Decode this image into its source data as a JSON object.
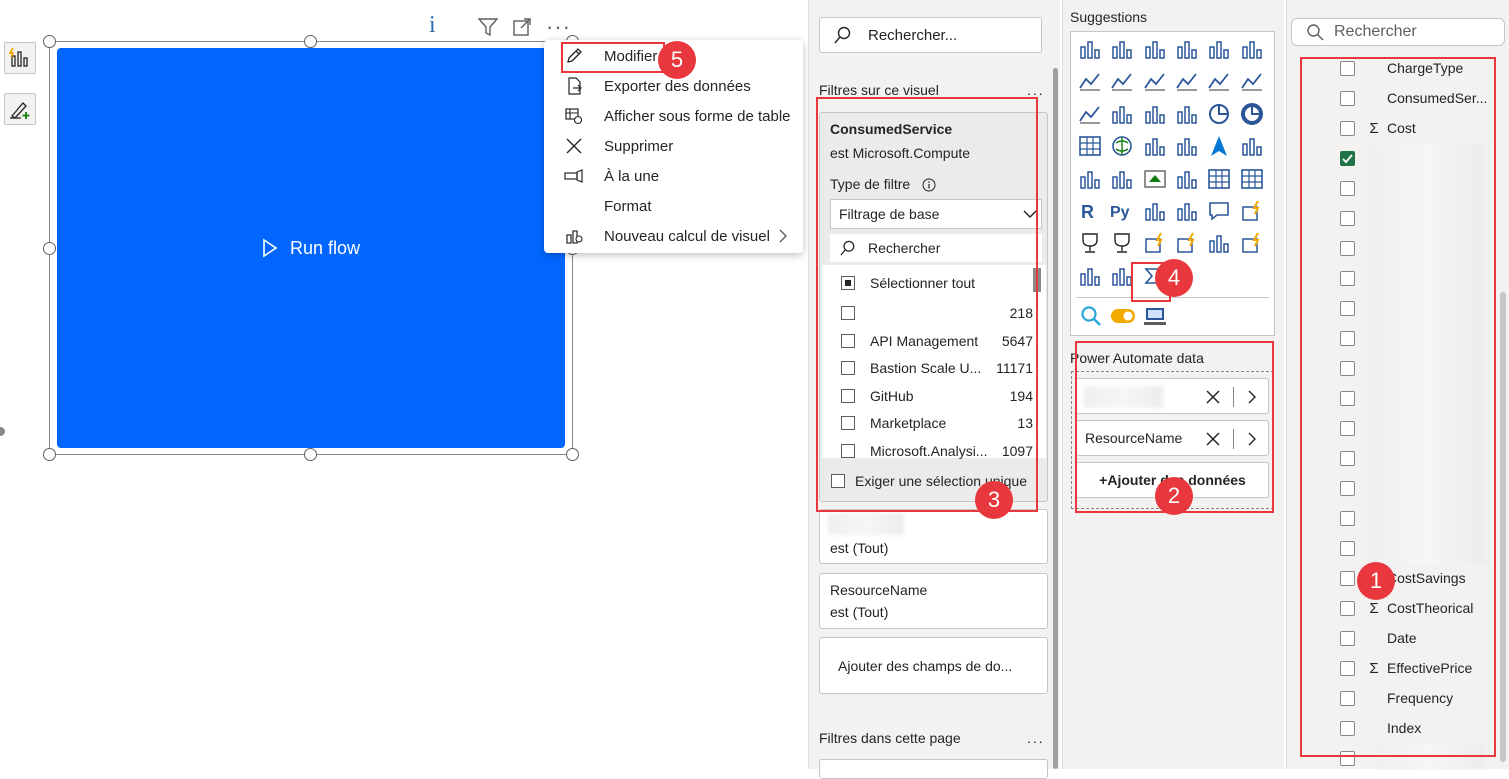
{
  "canvas": {
    "run_flow_label": "Run flow",
    "header_icons": [
      "info-icon",
      "filter-icon",
      "focus-mode-icon",
      "more-options-icon"
    ],
    "more_options": "···",
    "info_glyph": "i"
  },
  "context_menu": {
    "items": [
      {
        "label": "Modifier",
        "icon": "pencil-icon"
      },
      {
        "label": "Exporter des données",
        "icon": "export-icon"
      },
      {
        "label": "Afficher sous forme de table",
        "icon": "table-view-icon"
      },
      {
        "label": "Supprimer",
        "icon": "close-icon"
      },
      {
        "label": "À la une",
        "icon": "spotlight-icon"
      },
      {
        "label": "Format",
        "icon": ""
      },
      {
        "label": "Nouveau calcul de visuel",
        "icon": "calculator-icon"
      }
    ]
  },
  "filters": {
    "search_placeholder": "Rechercher...",
    "section_visual": "Filtres sur ce visuel",
    "section_page": "Filtres dans cette page",
    "more": "...",
    "active_card": {
      "title": "ConsumedService",
      "subtitle": "est Microsoft.Compute",
      "filter_type_label": "Type de filtre",
      "filter_type_value": "Filtrage de base",
      "search_placeholder": "Rechercher",
      "select_all": "Sélectionner tout",
      "rows": [
        {
          "label": "",
          "count": "218"
        },
        {
          "label": "API Management",
          "count": "5647"
        },
        {
          "label": "Bastion Scale U...",
          "count": "11171"
        },
        {
          "label": "GitHub",
          "count": "194"
        },
        {
          "label": "Marketplace",
          "count": "13"
        },
        {
          "label": "Microsoft.Analysi...",
          "count": "1097"
        }
      ],
      "require_single": "Exiger une sélection unique"
    },
    "card2_value": "est (Tout)",
    "card3_title": "ResourceName",
    "card3_value": "est (Tout)",
    "add_fields": "Ajouter des champs de do..."
  },
  "visualizations": {
    "suggestions_label": "Suggestions",
    "power_automate_label": "Power Automate data",
    "well_2_label": "ResourceName",
    "add_data": "+Ajouter des données"
  },
  "data": {
    "search_placeholder": "Rechercher",
    "fields": [
      {
        "name": "ChargeType",
        "sigma": false,
        "checked": false
      },
      {
        "name": "ConsumedSer...",
        "sigma": false,
        "checked": false
      },
      {
        "name": "Cost",
        "sigma": true,
        "checked": false
      },
      {
        "name": "",
        "sigma": false,
        "checked": true
      },
      {
        "name": "",
        "sigma": false,
        "checked": false
      },
      {
        "name": "",
        "sigma": false,
        "checked": false
      },
      {
        "name": "",
        "sigma": false,
        "checked": false
      },
      {
        "name": "",
        "sigma": false,
        "checked": false
      },
      {
        "name": "",
        "sigma": false,
        "checked": false
      },
      {
        "name": "",
        "sigma": false,
        "checked": false
      },
      {
        "name": "",
        "sigma": false,
        "checked": false
      },
      {
        "name": "",
        "sigma": false,
        "checked": false
      },
      {
        "name": "",
        "sigma": false,
        "checked": false
      },
      {
        "name": "",
        "sigma": false,
        "checked": false
      },
      {
        "name": "",
        "sigma": false,
        "checked": false
      },
      {
        "name": "",
        "sigma": false,
        "checked": false
      },
      {
        "name": "",
        "sigma": false,
        "checked": false
      },
      {
        "name": "CostSavings",
        "sigma": false,
        "checked": false
      },
      {
        "name": "CostTheorical",
        "sigma": true,
        "checked": false
      },
      {
        "name": "Date",
        "sigma": false,
        "checked": false
      },
      {
        "name": "EffectivePrice",
        "sigma": true,
        "checked": false
      },
      {
        "name": "Frequency",
        "sigma": false,
        "checked": false
      },
      {
        "name": "Index",
        "sigma": false,
        "checked": false
      },
      {
        "name": "",
        "sigma": false,
        "checked": false
      }
    ]
  },
  "annotations": {
    "badges": [
      "1",
      "2",
      "3",
      "4",
      "5"
    ]
  },
  "colors": {
    "accent": "#0066ff",
    "highlight": "#e8383d",
    "check": "#217346"
  }
}
